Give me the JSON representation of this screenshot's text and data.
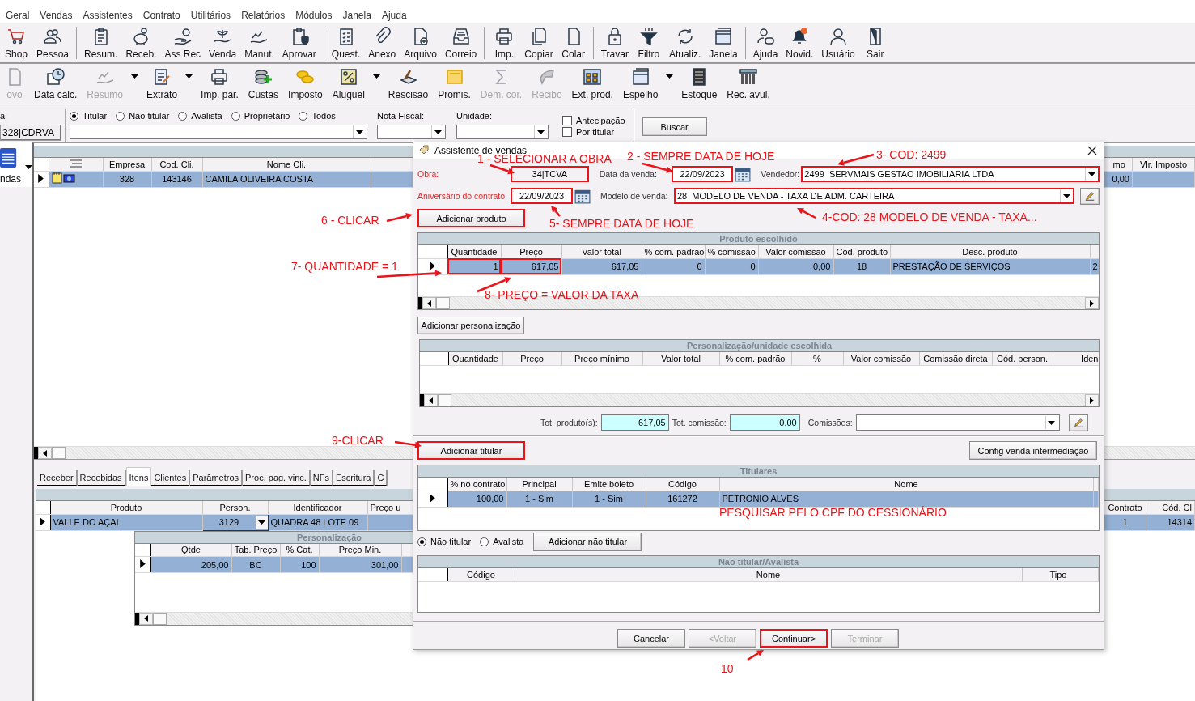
{
  "menu": [
    "Geral",
    "Vendas",
    "Assistentes",
    "Contrato",
    "Utilitários",
    "Relatórios",
    "Módulos",
    "Janela",
    "Ajuda"
  ],
  "toolbar_primary": [
    [
      {
        "label": "Shop",
        "kind": "cart"
      },
      {
        "label": "Pessoa",
        "kind": "people"
      }
    ],
    [
      {
        "label": "Resum.",
        "kind": "clipboard"
      },
      {
        "label": "Receb.",
        "kind": "piggybank"
      },
      {
        "label": "Ass Rec",
        "kind": "hand"
      },
      {
        "label": "Venda",
        "kind": "plant"
      },
      {
        "label": "Manut.",
        "kind": "chart"
      },
      {
        "label": "Aprovar",
        "kind": "shield"
      }
    ],
    [
      {
        "label": "Quest.",
        "kind": "checklist"
      },
      {
        "label": "Anexo",
        "kind": "paperclip"
      },
      {
        "label": "Arquivo",
        "kind": "document"
      },
      {
        "label": "Correio",
        "kind": "tray"
      }
    ],
    [
      {
        "label": "Imp.",
        "kind": "printer"
      },
      {
        "label": "Copiar",
        "kind": "copy"
      },
      {
        "label": "Colar",
        "kind": "page"
      }
    ],
    [
      {
        "label": "Travar",
        "kind": "padlock"
      },
      {
        "label": "Filtro",
        "kind": "funnel"
      },
      {
        "label": "Atualiz.",
        "kind": "refresh"
      },
      {
        "label": "Janela",
        "kind": "window"
      }
    ],
    [
      {
        "label": "Ajuda",
        "kind": "chat"
      },
      {
        "label": "Novid.",
        "kind": "bell"
      },
      {
        "label": "Usuário",
        "kind": "user"
      },
      {
        "label": "Sair",
        "kind": "door"
      }
    ]
  ],
  "toolbar_secondary": [
    {
      "label": "ovo",
      "kind": "page",
      "disabled": true,
      "dropdown": false
    },
    {
      "label": "Data calc.",
      "kind": "clock",
      "disabled": false,
      "dropdown": false
    },
    {
      "label": "Resumo",
      "kind": "chart",
      "disabled": true,
      "dropdown": true
    },
    {
      "label": "Extrato",
      "kind": "notepad",
      "disabled": false,
      "dropdown": true
    },
    {
      "label": "Imp. par.",
      "kind": "printer",
      "disabled": false,
      "dropdown": false
    },
    {
      "label": "Custas",
      "kind": "plus",
      "disabled": false,
      "dropdown": false
    },
    {
      "label": "Imposto",
      "kind": "coins",
      "disabled": false,
      "dropdown": false
    },
    {
      "label": "Aluguel",
      "kind": "percent",
      "disabled": false,
      "dropdown": true
    },
    {
      "label": "Rescisão",
      "kind": "pen",
      "disabled": false,
      "dropdown": false
    },
    {
      "label": "Promis.",
      "kind": "note",
      "disabled": false,
      "dropdown": false
    },
    {
      "label": "Dem. cor.",
      "kind": "sigma",
      "disabled": true,
      "dropdown": false
    },
    {
      "label": "Recibo",
      "kind": "stamp",
      "disabled": true,
      "dropdown": false
    },
    {
      "label": "Ext. prod.",
      "kind": "grid",
      "disabled": false,
      "dropdown": false
    },
    {
      "label": "Espelho",
      "kind": "window",
      "disabled": false,
      "dropdown": true
    },
    {
      "label": "Estoque",
      "kind": "server",
      "disabled": false,
      "dropdown": false
    },
    {
      "label": "Rec. avul.",
      "kind": "barcode",
      "disabled": false,
      "dropdown": false
    }
  ],
  "filter": {
    "company_label": "a:",
    "company": "328|CDRVA",
    "radios": [
      {
        "label": "Titular",
        "selected": true
      },
      {
        "label": "Não titular",
        "selected": false
      },
      {
        "label": "Avalista",
        "selected": false
      },
      {
        "label": "Proprietário",
        "selected": false
      },
      {
        "label": "Todos",
        "selected": false
      }
    ],
    "nota_fiscal_label": "Nota Fiscal:",
    "unidade_label": "Unidade:",
    "checkboxes": [
      {
        "label": "Antecipação",
        "checked": false
      },
      {
        "label": "Por titular",
        "checked": false
      }
    ],
    "search_button": "Buscar"
  },
  "sidebar": {
    "label": "ndas"
  },
  "sales_grid": {
    "columns": [
      "Empresa",
      "Cod. Cli.",
      "Nome Cli.",
      "imo",
      "Vlr. Imposto"
    ],
    "rows": [
      {
        "selected": true,
        "cells": [
          "328",
          "143146",
          "CAMILA OLIVEIRA COSTA",
          "0,00",
          null
        ]
      }
    ]
  },
  "tabs": [
    {
      "label": "Receber",
      "selected": false
    },
    {
      "label": "Recebidas",
      "selected": false
    },
    {
      "label": "Itens",
      "selected": true
    },
    {
      "label": "Clientes",
      "selected": false
    },
    {
      "label": "Parâmetros",
      "selected": false
    },
    {
      "label": "Proc. pag. vinc.",
      "selected": false
    },
    {
      "label": "NFs",
      "selected": false
    },
    {
      "label": "Escritura",
      "selected": false
    },
    {
      "label": "C",
      "selected": false
    }
  ],
  "items_grid": {
    "columns": [
      "Produto",
      "Person.",
      "Identificador",
      "Preço u",
      "Contrato",
      "Cód. Cl"
    ],
    "rows": [
      {
        "selected": true,
        "cells": [
          "VALLE DO AÇAI",
          "3129",
          "QUADRA 48 LOTE 09",
          null,
          "1",
          "14314"
        ]
      }
    ]
  },
  "personalization_grid": {
    "title": "Personalização",
    "columns": [
      "Qtde",
      "Tab. Preço",
      "% Cat.",
      "Preço Min."
    ],
    "rows": [
      {
        "selected": true,
        "cells": [
          "205,00",
          "BC",
          "100",
          "301,00"
        ]
      }
    ]
  },
  "dialog": {
    "title": "Assistente de vendas",
    "obra": {
      "label": "Obra:",
      "required": true,
      "value": "34|TCVA",
      "highlighted": true
    },
    "sale_date": {
      "label": "Data da venda:",
      "required": false,
      "value": "22/09/2023",
      "highlighted": true
    },
    "seller": {
      "label": "Vendedor:",
      "required": false,
      "value": "2499  SERVMAIS GESTAO IMOBILIARIA LTDA",
      "highlighted": true
    },
    "anniversary": {
      "label": "Aniversário do contrato:",
      "required": true,
      "value": "22/09/2023",
      "highlighted": true
    },
    "sale_model": {
      "label": "Modelo de venda:",
      "required": false,
      "value": "28  MODELO DE VENDA - TAXA DE ADM. CARTEIRA",
      "highlighted": true
    },
    "add_product_button": {
      "label": "Adicionar produto",
      "highlighted": true
    },
    "product_grid": {
      "title": "Produto escolhido",
      "columns": [
        "Quantidade",
        "Preço",
        "Valor total",
        "% com. padrão",
        "% comissão",
        "Valor comissão",
        "Cód. produto",
        "Desc. produto"
      ],
      "rows": [
        {
          "selected": true,
          "cells": [
            {
              "text": "1",
              "highlighted": true
            },
            {
              "text": "617,05",
              "highlighted": true
            },
            "617,05",
            "0",
            "0",
            "0,00",
            "18",
            "PRESTAÇÃO DE SERVIÇOS",
            "2"
          ]
        }
      ]
    },
    "add_personalization_button": {
      "label": "Adicionar personalização",
      "highlighted": false
    },
    "personalization_grid": {
      "title": "Personalização/unidade escolhida",
      "columns": [
        "Quantidade",
        "Preço",
        "Preço mínimo",
        "Valor total",
        "% com. padrão",
        "%",
        "Valor comissão",
        "Comissão direta",
        "Cód. person.",
        "Iden"
      ]
    },
    "total_products": {
      "label": "Tot. produto(s):",
      "value": "617,05"
    },
    "total_commission": {
      "label": "Tot. comissão:",
      "value": "0,00"
    },
    "commissions_label": "Comissões:",
    "add_holder_button": {
      "label": "Adicionar titular",
      "highlighted": true
    },
    "config_button": {
      "label": "Config venda intermediação",
      "highlighted": false
    },
    "holders_grid": {
      "title": "Titulares",
      "columns": [
        "% no contrato",
        "Principal",
        "Emite boleto",
        "Código",
        "Nome"
      ],
      "rows": [
        {
          "selected": true,
          "cells": [
            "100,00",
            "1 - Sim",
            "1 - Sim",
            "161272",
            "PETRONIO ALVES"
          ]
        }
      ]
    },
    "role_radios": [
      {
        "label": "Não titular",
        "selected": true
      },
      {
        "label": "Avalista",
        "selected": false
      }
    ],
    "add_non_holder_button": {
      "label": "Adicionar não titular",
      "highlighted": false
    },
    "non_holders_grid": {
      "title": "Não titular/Avalista",
      "columns": [
        "Código",
        "Nome",
        "Tipo"
      ]
    },
    "footer_buttons": [
      {
        "label": "Cancelar",
        "disabled": false,
        "highlighted": false
      },
      {
        "label": "<Voltar",
        "disabled": true,
        "highlighted": false
      },
      {
        "label": "Continuar>",
        "disabled": false,
        "highlighted": true
      },
      {
        "label": "Terminar",
        "disabled": true,
        "highlighted": false
      }
    ]
  },
  "annotations": [
    "1 - SELECIONAR A OBRA",
    "2 - SEMPRE DATA DE HOJE",
    "3- COD: 2499",
    "4-COD: 28 MODELO DE VENDA - TAXA...",
    "5- SEMPRE DATA DE HOJE",
    "6 - CLICAR",
    "7- QUANTIDADE = 1",
    "8- PREÇO = VALOR DA TAXA",
    "9-CLICAR",
    "PESQUISAR PELO CPF DO CESSIONÁRIO",
    "10"
  ]
}
